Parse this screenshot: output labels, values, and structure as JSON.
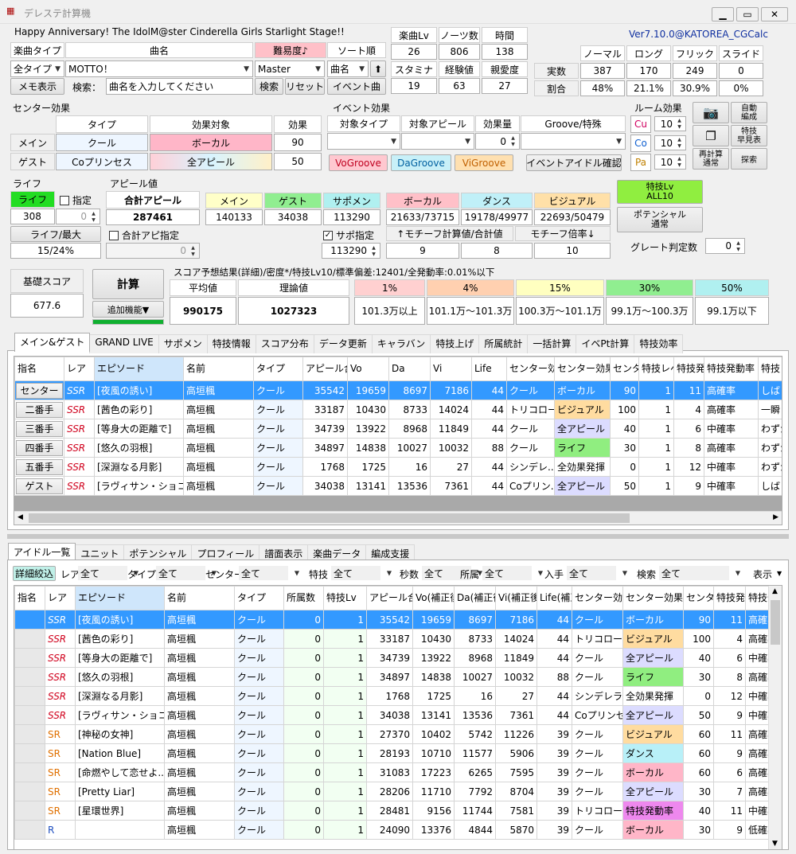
{
  "window": {
    "title": "デレステ計算機",
    "version": "Ver7.10.0@KATOREA_CGCalc",
    "song_title": "Happy Anniversary! The IdolM@ster Cinderella Girls Starlight Stage!!"
  },
  "controls": {
    "song_type_label": "楽曲タイプ",
    "song_name_label": "曲名",
    "difficulty_label": "難易度♪",
    "sort_label": "ソート順",
    "song_type_value": "全タイプ",
    "song_name_value": "MOTTO！",
    "difficulty_value": "Master",
    "sort_value": "曲名",
    "sort_dir": "⬆",
    "memo_button": "メモ表示",
    "search_label": "検索：",
    "search_placeholder": "曲名を入力してください",
    "search_button": "検索",
    "reset_button": "リセット",
    "event_song_button": "イベント曲"
  },
  "song_stats": {
    "headers": [
      "楽曲Lv",
      "ノーツ数",
      "時間",
      "スタミナ",
      "経験値",
      "親愛度"
    ],
    "values": [
      "26",
      "806",
      "138",
      "19",
      "63",
      "27"
    ]
  },
  "notes": {
    "headers": [
      "ノーマル",
      "ロング",
      "フリック",
      "スライド"
    ],
    "row_labels": [
      "実数",
      "割合"
    ],
    "counts": [
      "387",
      "170",
      "249",
      "0"
    ],
    "ratios": [
      "48%",
      "21.1%",
      "30.9%",
      "0%"
    ]
  },
  "center_effect": {
    "title": "センター効果",
    "col_headers": [
      "タイプ",
      "効果対象",
      "効果"
    ],
    "rows": [
      {
        "label": "メイン",
        "type": "クール",
        "target": "ボーカル",
        "value": "90"
      },
      {
        "label": "ゲスト",
        "type": "Coプリンセス",
        "target": "全アピール",
        "value": "50"
      }
    ]
  },
  "event_effect": {
    "title": "イベント効果",
    "headers": [
      "対象タイプ",
      "対象アピール",
      "効果量",
      "Groove/特殊"
    ],
    "amount": "0",
    "groove_buttons": [
      "VoGroove",
      "DaGroove",
      "ViGroove"
    ],
    "confirm_button": "イベントアイドル確認"
  },
  "room_effect": {
    "title": "ルーム効果",
    "rows": [
      {
        "label": "Cu",
        "value": "10"
      },
      {
        "label": "Co",
        "value": "10"
      },
      {
        "label": "Pa",
        "value": "10"
      }
    ]
  },
  "side_buttons": {
    "camera": "camera-icon",
    "auto_form": "自動\n編成",
    "skill_table": "特技\n早見表",
    "recalc": "再計算\n通常",
    "search": "探索"
  },
  "life": {
    "title": "ライフ",
    "label": "ライフ",
    "specify": "指定",
    "value": "308",
    "spin": "0",
    "ratio_label": "ライフ/最大",
    "ratio_value": "15/24%"
  },
  "appeal": {
    "title": "アピール値",
    "total_label": "合計アピール",
    "total_value": "287461",
    "total_specify": "合計アピ指定",
    "headers": [
      "メイン",
      "ゲスト",
      "サポメン"
    ],
    "values": [
      "140133",
      "34038",
      "113290"
    ],
    "support_specify": "サポ指定",
    "support_value": "113290",
    "attr_headers": [
      "ボーカル",
      "ダンス",
      "ビジュアル"
    ],
    "attr_values": [
      "21633/73715",
      "19178/49977",
      "22693/50479"
    ],
    "motif_label": "↑モチーフ計算値/合計値",
    "motif_rate_label": "モチーフ倍率↓",
    "motif_values": [
      "9",
      "8",
      "10"
    ]
  },
  "skill_panel": {
    "skill_lv_button": "特技Lv\nALL10",
    "potential_button": "ポテンシャル\n通常",
    "great_label": "グレート判定数",
    "great_value": "0"
  },
  "score": {
    "base_label": "基礎スコア",
    "base_value": "677.6",
    "calc_button": "計算",
    "extra_button": "追加機能▼",
    "progress": 1.0,
    "summary": "スコア予想結果(詳細)/密度*/特技Lv10/標準偏差:12401/全発動率:0.01%以下",
    "avg_label": "平均値",
    "avg_value": "990175",
    "theory_label": "理論値",
    "theory_value": "1027323",
    "pct_headers": [
      "1%",
      "4%",
      "15%",
      "30%",
      "50%"
    ],
    "pct_values": [
      "101.3万以上",
      "101.1万〜101.3万",
      "100.3万〜101.1万",
      "99.1万〜100.3万",
      "99.1万以下"
    ],
    "pct_colors": [
      "#ffd0d0",
      "#ffd0b0",
      "#ffffc0",
      "#90ee90",
      "#b0f0f0"
    ]
  },
  "top_tabs": [
    "メイン&ゲスト",
    "GRAND LIVE",
    "サポメン",
    "特技情報",
    "スコア分布",
    "データ更新",
    "キャラバン",
    "特技上げ",
    "所属統計",
    "一括計算",
    "イベPt計算",
    "特技効率"
  ],
  "unit_table": {
    "headers": [
      "指名",
      "レア",
      "エピソード",
      "名前",
      "タイプ",
      "アピール合計",
      "Vo",
      "Da",
      "Vi",
      "Life",
      "センター効果タイプ",
      "センター効果対象",
      "センター",
      "特技レベル",
      "特技発動",
      "特技発動率",
      "特技"
    ],
    "rows": [
      {
        "slot": "センター",
        "rare": "SSR",
        "ep": "[夜風の誘い]",
        "name": "高垣楓",
        "type": "クール",
        "ap": "35542",
        "vo": "19659",
        "da": "8697",
        "vi": "7186",
        "life": "44",
        "ct": "クール",
        "cg": "ボーカル",
        "cv": "90",
        "sl": "1",
        "sd": "11",
        "sr": "高確率",
        "sk": "しばら"
      },
      {
        "slot": "二番手",
        "rare": "SSR",
        "ep": "[茜色の彩り]",
        "name": "高垣楓",
        "type": "クール",
        "ap": "33187",
        "vo": "10430",
        "da": "8733",
        "vi": "14024",
        "life": "44",
        "ct": "トリコロール",
        "cg": "ビジュアル",
        "cv": "100",
        "sl": "1",
        "sd": "4",
        "sr": "高確率",
        "sk": "一瞬"
      },
      {
        "slot": "三番手",
        "rare": "SSR",
        "ep": "[等身大の距離で]",
        "name": "高垣楓",
        "type": "クール",
        "ap": "34739",
        "vo": "13922",
        "da": "8968",
        "vi": "11849",
        "life": "44",
        "ct": "クール",
        "cg": "全アピール",
        "cv": "40",
        "sl": "1",
        "sd": "6",
        "sr": "中確率",
        "sk": "わずか"
      },
      {
        "slot": "四番手",
        "rare": "SSR",
        "ep": "[悠久の羽根]",
        "name": "高垣楓",
        "type": "クール",
        "ap": "34897",
        "vo": "14838",
        "da": "10027",
        "vi": "10032",
        "life": "88",
        "ct": "クール",
        "cg": "ライフ",
        "cv": "30",
        "sl": "1",
        "sd": "8",
        "sr": "高確率",
        "sk": "わずか"
      },
      {
        "slot": "五番手",
        "rare": "SSR",
        "ep": "[深淵なる月影]",
        "name": "高垣楓",
        "type": "クール",
        "ap": "1768",
        "vo": "1725",
        "da": "16",
        "vi": "27",
        "life": "44",
        "ct": "シンデレ...",
        "cg": "全効果発揮",
        "cv": "0",
        "sl": "1",
        "sd": "12",
        "sr": "中確率",
        "sk": "わずか"
      },
      {
        "slot": "ゲスト",
        "rare": "SSR",
        "ep": "[ラヴィサン・ショコラ]",
        "name": "高垣楓",
        "type": "クール",
        "ap": "34038",
        "vo": "13141",
        "da": "13536",
        "vi": "7361",
        "life": "44",
        "ct": "Coプリン...",
        "cg": "全アピール",
        "cv": "50",
        "sl": "1",
        "sd": "9",
        "sr": "中確率",
        "sk": "しばら"
      }
    ]
  },
  "bottom_tabs": [
    "アイドル一覧",
    "ユニット",
    "ポテンシャル",
    "プロフィール",
    "譜面表示",
    "楽曲データ",
    "編成支援"
  ],
  "filter_bar": {
    "detail_button": "詳細絞込",
    "items": [
      {
        "label": "レア",
        "value": "全て"
      },
      {
        "label": "タイプ",
        "value": "全て"
      },
      {
        "label": "センター",
        "value": "全て"
      },
      {
        "label": "特技",
        "value": "全て"
      },
      {
        "label": "秒数",
        "value": "全て"
      },
      {
        "label": "所属",
        "value": "全て"
      },
      {
        "label": "入手",
        "value": "全て"
      },
      {
        "label": "検索",
        "value": "全て"
      }
    ],
    "display_label": "表示"
  },
  "idol_table": {
    "headers": [
      "指名",
      "レア",
      "エピソード",
      "名前",
      "タイプ",
      "所属数",
      "特技Lv",
      "アピール合計",
      "Vo(補正後)",
      "Da(補正後)",
      "Vi(補正後)",
      "Life(補正)",
      "センター効果タイプ",
      "センター効果対象",
      "センター",
      "特技発動",
      "特技発"
    ],
    "rows": [
      {
        "rare": "SSR",
        "ep": "[夜風の誘い]",
        "name": "高垣楓",
        "type": "クール",
        "own": "0",
        "lv": "1",
        "ap": "35542",
        "vo": "19659",
        "da": "8697",
        "vi": "7186",
        "life": "44",
        "ct": "クール",
        "cg": "ボーカル",
        "cv": "90",
        "sd": "11",
        "sr": "高確率"
      },
      {
        "rare": "SSR",
        "ep": "[茜色の彩り]",
        "name": "高垣楓",
        "type": "クール",
        "own": "0",
        "lv": "1",
        "ap": "33187",
        "vo": "10430",
        "da": "8733",
        "vi": "14024",
        "life": "44",
        "ct": "トリコロール",
        "cg": "ビジュアル",
        "cv": "100",
        "sd": "4",
        "sr": "高確率"
      },
      {
        "rare": "SSR",
        "ep": "[等身大の距離で]",
        "name": "高垣楓",
        "type": "クール",
        "own": "0",
        "lv": "1",
        "ap": "34739",
        "vo": "13922",
        "da": "8968",
        "vi": "11849",
        "life": "44",
        "ct": "クール",
        "cg": "全アピール",
        "cv": "40",
        "sd": "6",
        "sr": "中確率"
      },
      {
        "rare": "SSR",
        "ep": "[悠久の羽根]",
        "name": "高垣楓",
        "type": "クール",
        "own": "0",
        "lv": "1",
        "ap": "34897",
        "vo": "14838",
        "da": "10027",
        "vi": "10032",
        "life": "88",
        "ct": "クール",
        "cg": "ライフ",
        "cv": "30",
        "sd": "8",
        "sr": "高確率"
      },
      {
        "rare": "SSR",
        "ep": "[深淵なる月影]",
        "name": "高垣楓",
        "type": "クール",
        "own": "0",
        "lv": "1",
        "ap": "1768",
        "vo": "1725",
        "da": "16",
        "vi": "27",
        "life": "44",
        "ct": "シンデレラ...",
        "cg": "全効果発揮",
        "cv": "0",
        "sd": "12",
        "sr": "中確率"
      },
      {
        "rare": "SSR",
        "ep": "[ラヴィサン・ショコラ]",
        "name": "高垣楓",
        "type": "クール",
        "own": "0",
        "lv": "1",
        "ap": "34038",
        "vo": "13141",
        "da": "13536",
        "vi": "7361",
        "life": "44",
        "ct": "Coプリンセス",
        "cg": "全アピール",
        "cv": "50",
        "sd": "9",
        "sr": "中確率"
      },
      {
        "rare": "SR",
        "ep": "[神秘の女神]",
        "name": "高垣楓",
        "type": "クール",
        "own": "0",
        "lv": "1",
        "ap": "27370",
        "vo": "10402",
        "da": "5742",
        "vi": "11226",
        "life": "39",
        "ct": "クール",
        "cg": "ビジュアル",
        "cv": "60",
        "sd": "11",
        "sr": "高確率"
      },
      {
        "rare": "SR",
        "ep": "[Nation Blue]",
        "name": "高垣楓",
        "type": "クール",
        "own": "0",
        "lv": "1",
        "ap": "28193",
        "vo": "10710",
        "da": "11577",
        "vi": "5906",
        "life": "39",
        "ct": "クール",
        "cg": "ダンス",
        "cv": "60",
        "sd": "9",
        "sr": "高確率"
      },
      {
        "rare": "SR",
        "ep": "[命燃やして恋せよ...",
        "name": "高垣楓",
        "type": "クール",
        "own": "0",
        "lv": "1",
        "ap": "31083",
        "vo": "17223",
        "da": "6265",
        "vi": "7595",
        "life": "39",
        "ct": "クール",
        "cg": "ボーカル",
        "cv": "60",
        "sd": "6",
        "sr": "高確率"
      },
      {
        "rare": "SR",
        "ep": "[Pretty Liar]",
        "name": "高垣楓",
        "type": "クール",
        "own": "0",
        "lv": "1",
        "ap": "28206",
        "vo": "11710",
        "da": "7792",
        "vi": "8704",
        "life": "39",
        "ct": "クール",
        "cg": "全アピール",
        "cv": "30",
        "sd": "7",
        "sr": "高確率"
      },
      {
        "rare": "SR",
        "ep": "[星環世界]",
        "name": "高垣楓",
        "type": "クール",
        "own": "0",
        "lv": "1",
        "ap": "28481",
        "vo": "9156",
        "da": "11744",
        "vi": "7581",
        "life": "39",
        "ct": "トリコロール",
        "cg": "特技発動率",
        "cv": "40",
        "sd": "11",
        "sr": "中確率"
      },
      {
        "rare": "R",
        "ep": "",
        "name": "高垣楓",
        "type": "クール",
        "own": "0",
        "lv": "1",
        "ap": "24090",
        "vo": "13376",
        "da": "4844",
        "vi": "5870",
        "life": "39",
        "ct": "クール",
        "cg": "ボーカル",
        "cv": "30",
        "sd": "9",
        "sr": "低確率"
      }
    ]
  },
  "target_colors": {
    "ボーカル": "#ffb6c8",
    "ビジュアル": "#ffdca0",
    "全アピール": "#dcdcff",
    "ライフ": "#90ee80",
    "全効果発揮": "#ffffff",
    "ダンス": "#b8f0f8",
    "特技発動率": "#ee88ee"
  }
}
